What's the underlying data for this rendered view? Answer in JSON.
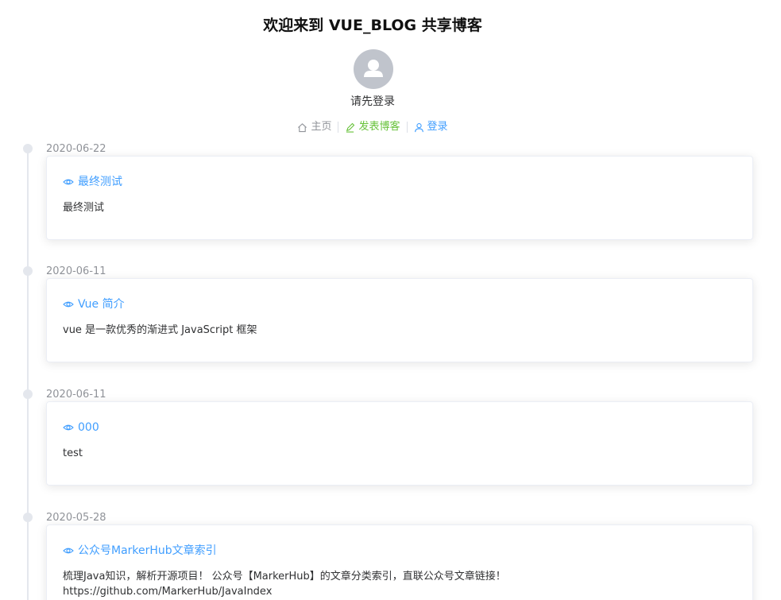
{
  "header": {
    "title": "欢迎来到 VUE_BLOG 共享博客",
    "login_prompt": "请先登录"
  },
  "nav": {
    "home_label": "主页",
    "publish_label": "发表博客",
    "login_label": "登录"
  },
  "timeline": [
    {
      "date": "2020-06-22",
      "title": "最终测试",
      "description": [
        "最终测试"
      ]
    },
    {
      "date": "2020-06-11",
      "title": "Vue 简介",
      "description": [
        "vue 是一款优秀的渐进式 JavaScript 框架"
      ]
    },
    {
      "date": "2020-06-11",
      "title": "000",
      "description": [
        "test"
      ]
    },
    {
      "date": "2020-05-28",
      "title": "公众号MarkerHub文章索引",
      "description": [
        "梳理Java知识，解析开源项目！ 公众号【MarkerHub】的文章分类索引，直联公众号文章链接！",
        "https://github.com/MarkerHub/JavaIndex"
      ]
    }
  ],
  "colors": {
    "link": "#409eff",
    "publish": "#67c23a",
    "muted": "#909399",
    "avatar_bg": "#c0c4cc",
    "timeline": "#e4e7ed"
  },
  "icons": {
    "home": "home-icon",
    "publish": "edit-icon",
    "login": "user-icon",
    "view": "eye-icon",
    "avatar": "user-avatar-icon"
  }
}
